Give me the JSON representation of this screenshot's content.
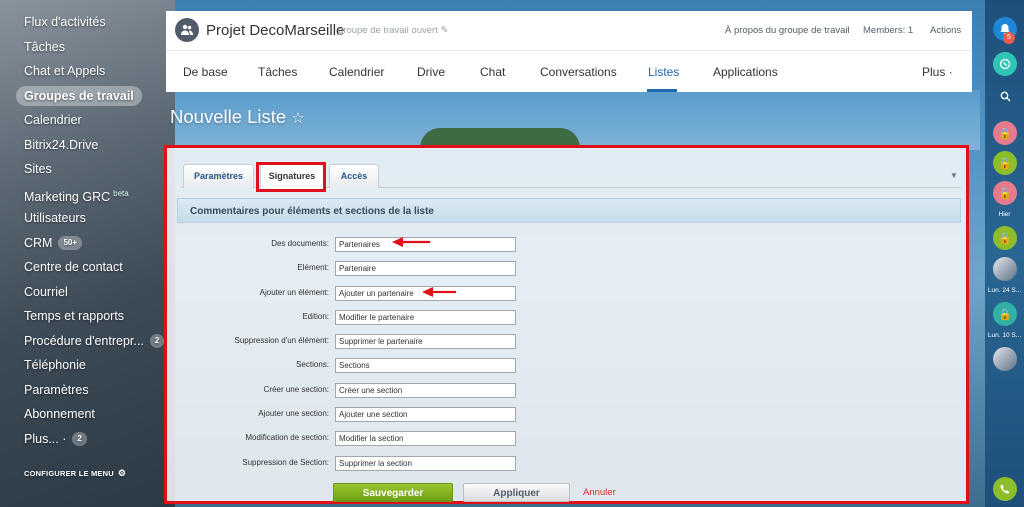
{
  "left_menu": {
    "items": [
      {
        "label": "Flux d'activités"
      },
      {
        "label": "Tâches"
      },
      {
        "label": "Chat et Appels"
      },
      {
        "label": "Groupes de travail",
        "active": true
      },
      {
        "label": "Calendrier"
      },
      {
        "label": "Bitrix24.Drive"
      },
      {
        "label": "Sites"
      },
      {
        "label": "Marketing GRC",
        "sup": "beta"
      },
      {
        "label": "Utilisateurs"
      },
      {
        "label": "CRM",
        "badge": "50+"
      },
      {
        "label": "Centre de contact"
      },
      {
        "label": "Courriel"
      },
      {
        "label": "Temps et rapports"
      },
      {
        "label": "Procédure d'entrepr...",
        "badge": "2"
      },
      {
        "label": "Téléphonie"
      },
      {
        "label": "Paramètres"
      },
      {
        "label": "Abonnement"
      },
      {
        "label": "Plus... ·",
        "badge": "2"
      }
    ],
    "config_label": "CONFIGURER LE MENU"
  },
  "right_bar": {
    "notif_count": "5",
    "labels": {
      "yesterday": "Hier",
      "date1": "Lun. 24 S...",
      "date2": "Lun. 10 S..."
    }
  },
  "group": {
    "title": "Projet DecoMarseille",
    "type": "groupe de travail ouvert",
    "about": "À propos du groupe de travail",
    "members": "Members: 1",
    "actions": "Actions",
    "tabs": [
      "De base",
      "Tâches",
      "Calendrier",
      "Drive",
      "Chat",
      "Conversations",
      "Listes",
      "Applications"
    ],
    "active_tab": "Listes",
    "more": "Plus ·"
  },
  "page": {
    "title": "Nouvelle Liste",
    "star": "☆"
  },
  "form_tabs": {
    "items": [
      "Paramètres",
      "Signatures",
      "Accès"
    ],
    "active": "Signatures"
  },
  "section": {
    "heading": "Commentaires pour éléments et sections de la liste"
  },
  "fields": [
    {
      "label": "Des documents:",
      "value": "Partenaires"
    },
    {
      "label": "Elément:",
      "value": "Partenaire"
    },
    {
      "label": "Ajouter un élément:",
      "value": "Ajouter un partenaire"
    },
    {
      "label": "Edition:",
      "value": "Modifier le partenaire"
    },
    {
      "label": "Suppression d'un élément:",
      "value": "Supprimer le partenaire"
    },
    {
      "label": "Sections:",
      "value": "Sections"
    },
    {
      "label": "Créer une section:",
      "value": "Créer une section"
    },
    {
      "label": "Ajouter une section:",
      "value": "Ajouter une section"
    },
    {
      "label": "Modification de section:",
      "value": "Modifier la section"
    },
    {
      "label": "Suppression de Section:",
      "value": "Supprimer la section"
    }
  ],
  "buttons": {
    "save": "Sauvegarder",
    "apply": "Appliquer",
    "cancel": "Annuler"
  },
  "colors": {
    "highlight": "#e0101a",
    "accent": "#2067b0",
    "save_green": "#8ab829"
  }
}
